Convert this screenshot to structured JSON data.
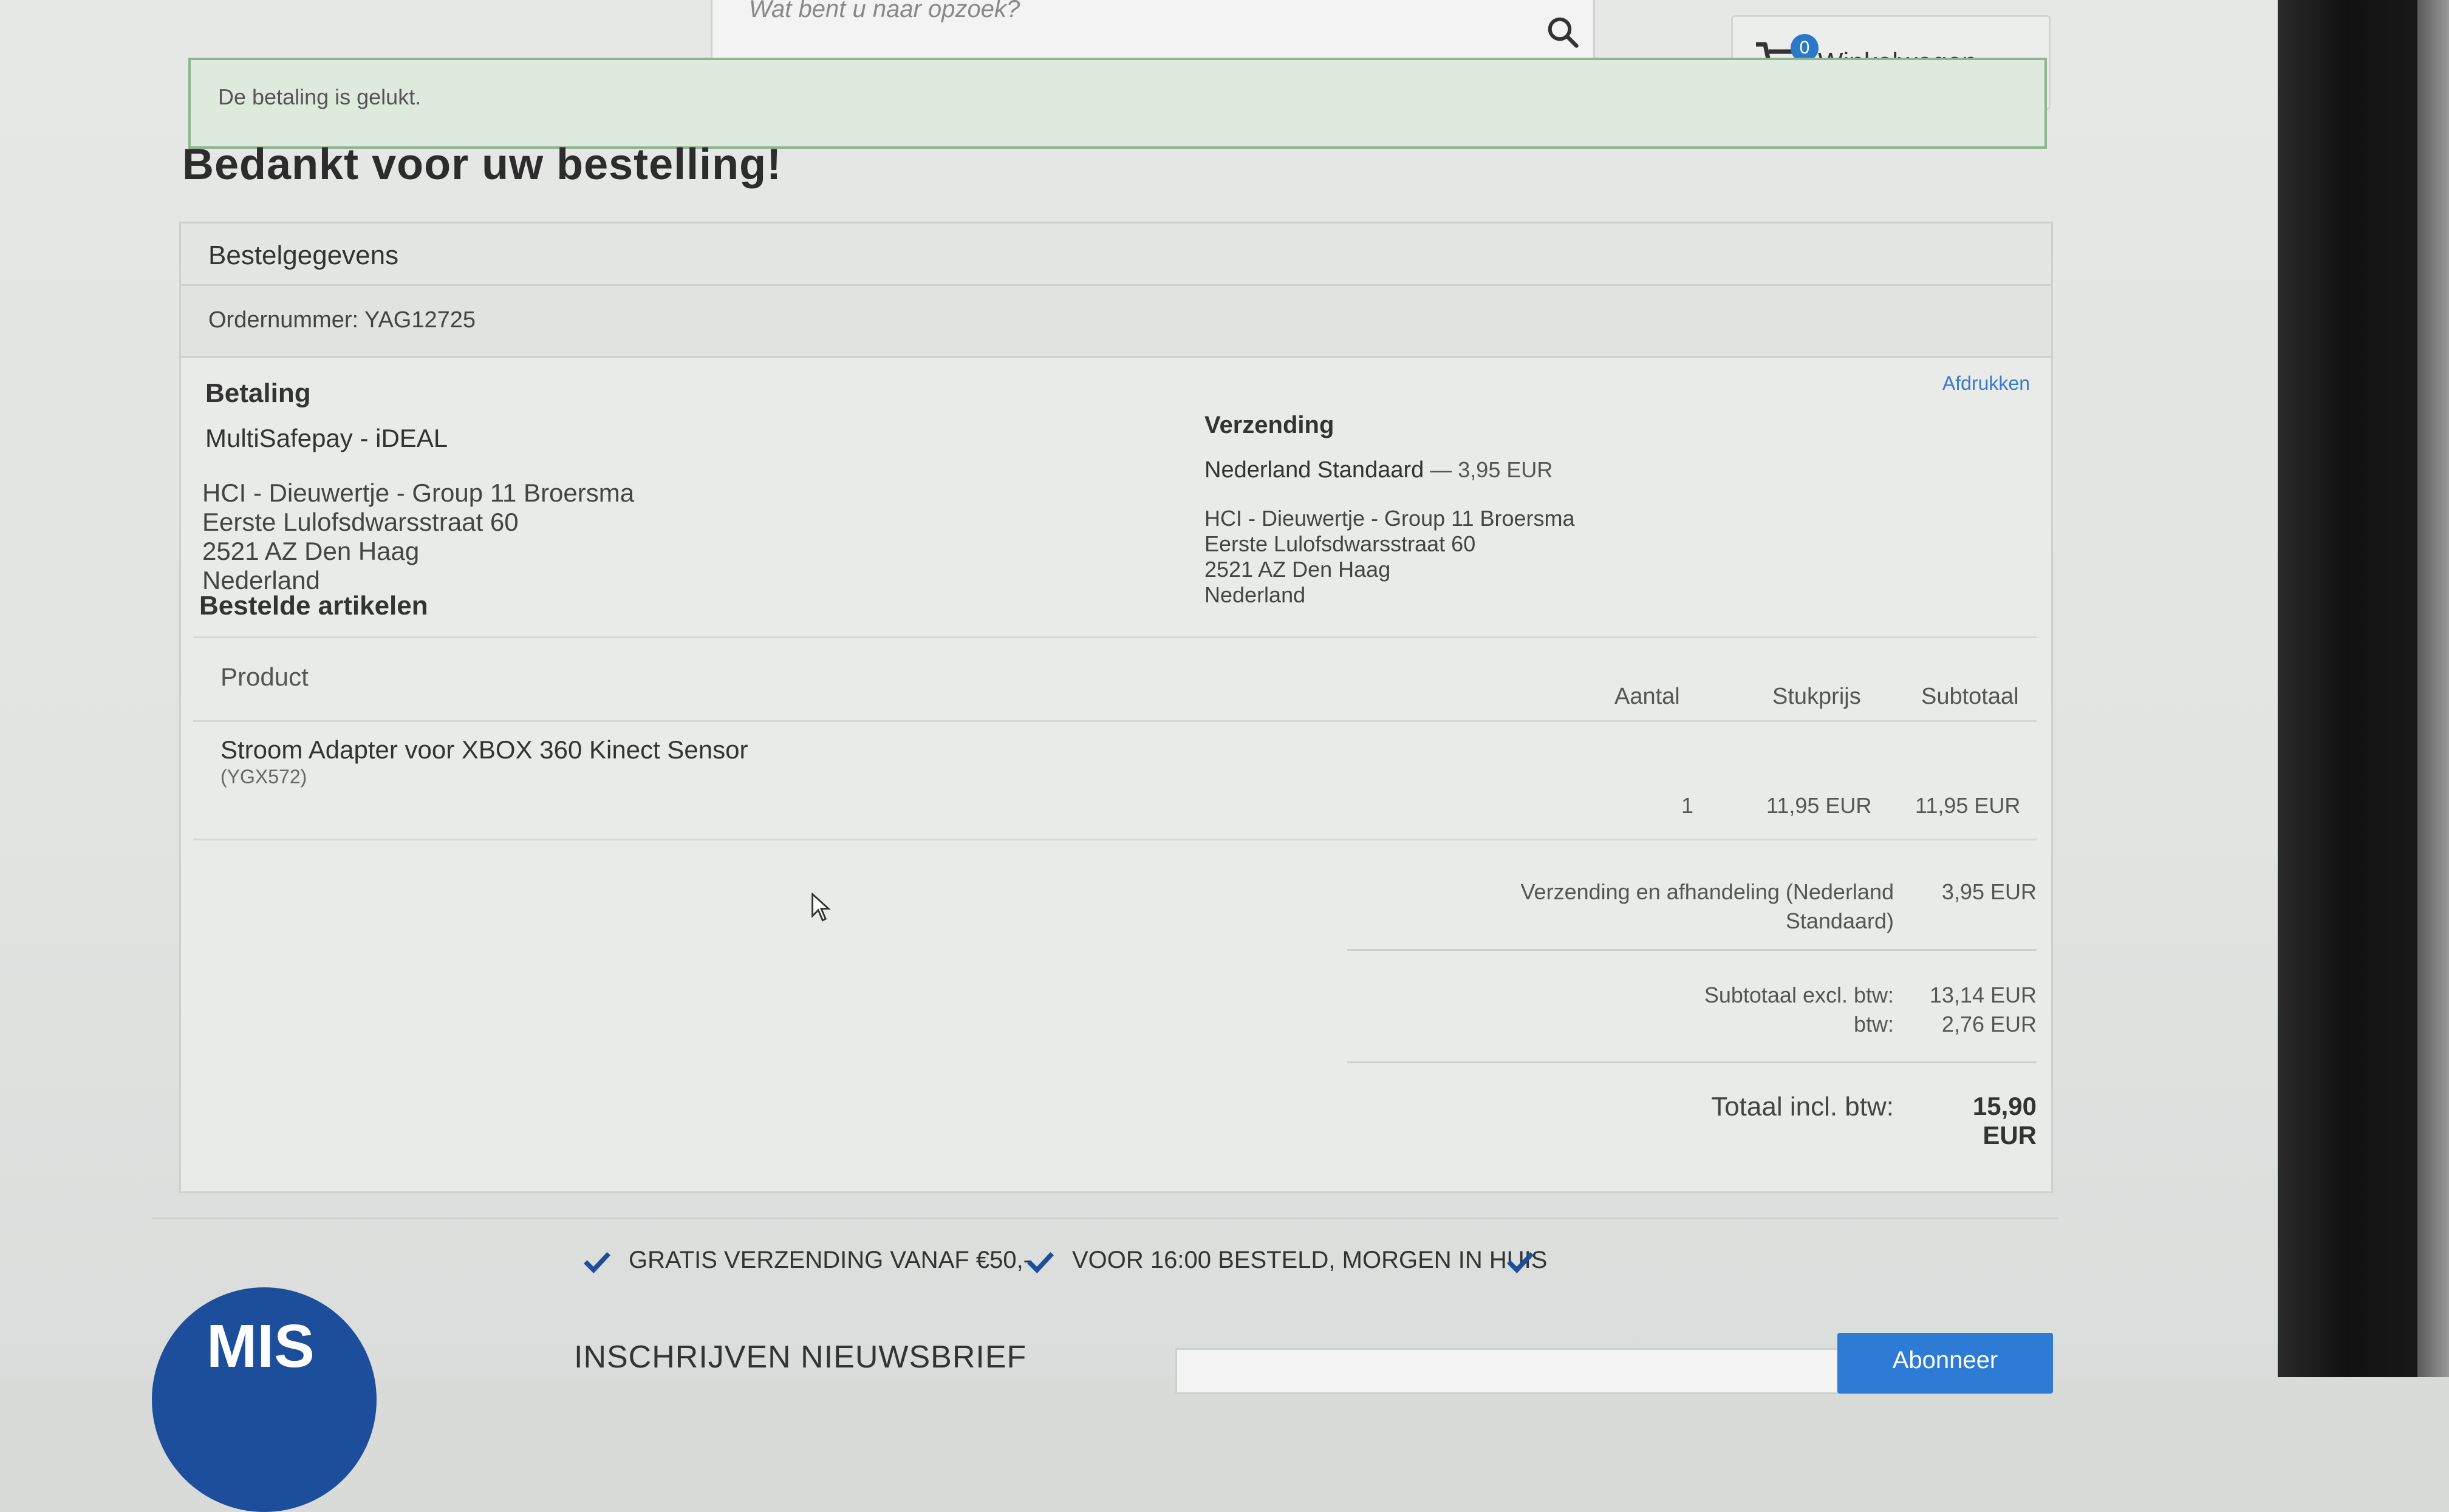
{
  "header": {
    "search_placeholder": "Wat bent u naar opzoek?",
    "cart_count": "0",
    "cart_label": "Winkelwagen"
  },
  "success_message": "De betaling is gelukt.",
  "page_title": "Bedankt voor uw bestelling!",
  "order": {
    "heading": "Bestelgegevens",
    "order_number": "Ordernummer: YAG12725",
    "print_label": "Afdrukken",
    "payment": {
      "heading": "Betaling",
      "method": "MultiSafepay - iDEAL",
      "address": [
        "HCI - Dieuwertje - Group 11 Broersma",
        "Eerste Lulofsdwarsstraat 60",
        "2521 AZ Den Haag",
        "Nederland"
      ]
    },
    "shipping": {
      "heading": "Verzending",
      "method": "Nederland Standaard",
      "price": " — 3,95 EUR",
      "address": [
        "HCI - Dieuwertje - Group 11 Broersma",
        "Eerste Lulofsdwarsstraat 60",
        "2521 AZ Den Haag",
        "Nederland"
      ]
    },
    "items_heading": "Bestelde artikelen",
    "columns": {
      "product": "Product",
      "qty": "Aantal",
      "unit_price": "Stukprijs",
      "subtotal": "Subtotaal"
    },
    "items": [
      {
        "name": "Stroom Adapter voor XBOX 360 Kinect Sensor",
        "sku": "(YGX572)",
        "qty": "1",
        "unit_price": "11,95 EUR",
        "subtotal": "11,95 EUR"
      }
    ],
    "totals": {
      "shipping_label_1": "Verzending en afhandeling (Nederland",
      "shipping_label_2": "Standaard)",
      "shipping_value": "3,95 EUR",
      "subtotal_excl_label": "Subtotaal excl. btw:",
      "subtotal_excl_value": "13,14 EUR",
      "vat_label": "btw:",
      "vat_value": "2,76 EUR",
      "grand_label": "Totaal incl. btw:",
      "grand_value": "15,90 EUR"
    }
  },
  "footer": {
    "usp_1": "GRATIS VERZENDING VANAF €50,-",
    "usp_2": "VOOR 16:00 BESTELD, MORGEN IN HUIS",
    "mascot_text": "MIS",
    "newsletter_label": "INSCHRIJVEN NIEUWSBRIEF",
    "subscribe_label": "Abonneer"
  },
  "colors": {
    "accent": "#2e7bd6",
    "success_border": "#8fb48f",
    "link": "#3a7bc8",
    "check": "#1d4e9c"
  },
  "icons": [
    "search-icon",
    "cart-icon",
    "chevron-down-icon",
    "check-icon",
    "cursor-icon"
  ]
}
